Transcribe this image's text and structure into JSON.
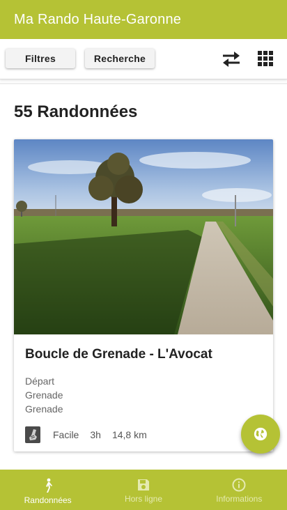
{
  "appbar": {
    "title": "Ma Rando Haute-Garonne"
  },
  "toolbar": {
    "filters_label": "Filtres",
    "search_label": "Recherche",
    "sort_icon": "swap-icon",
    "view_icon": "grid-icon"
  },
  "list": {
    "count_heading": "55 Randonnées",
    "items": [
      {
        "title": "Boucle de Grenade - L'Avocat",
        "depart_label": "Départ",
        "depart_value": "Grenade",
        "arrivee_value": "Grenade",
        "difficulty": "Facile",
        "duration": "3h",
        "distance": "14,8 km"
      }
    ]
  },
  "fab": {
    "icon": "globe-icon"
  },
  "bottom_nav": {
    "items": [
      {
        "label": "Randonnées",
        "icon": "hiker-icon",
        "active": true
      },
      {
        "label": "Hors ligne",
        "icon": "save-icon",
        "active": false
      },
      {
        "label": "Informations",
        "icon": "info-icon",
        "active": false
      }
    ]
  },
  "colors": {
    "brand": "#b5c235",
    "text": "#222222",
    "muted": "#666666"
  }
}
